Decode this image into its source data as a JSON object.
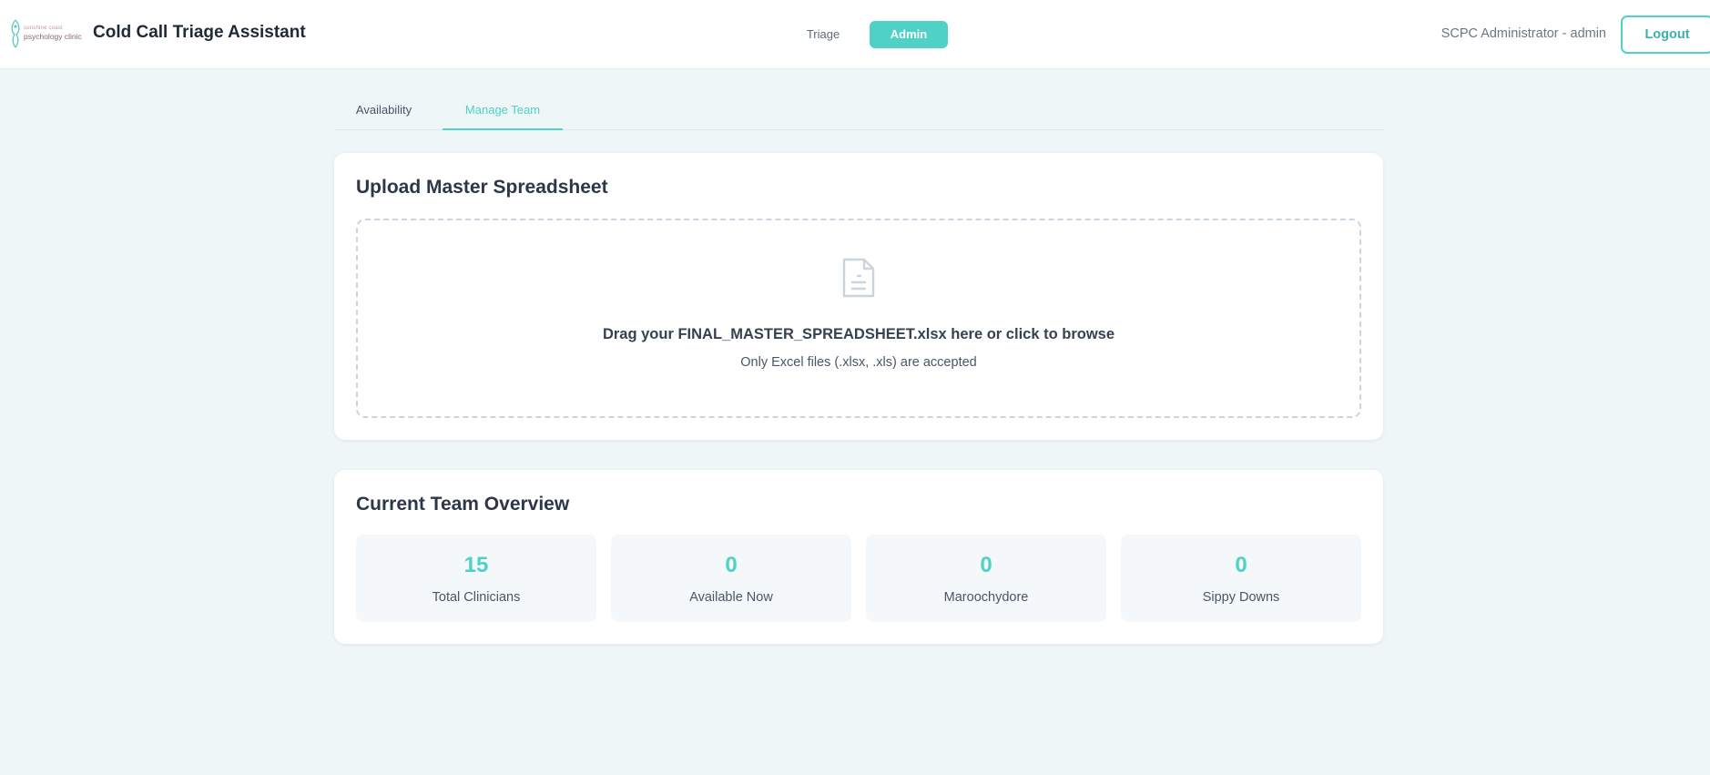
{
  "header": {
    "logo_top": "sunshine coast",
    "logo_main": "psychology clinic",
    "app_title": "Cold Call Triage Assistant",
    "nav": [
      {
        "label": "Triage",
        "active": false
      },
      {
        "label": "Admin",
        "active": true
      }
    ],
    "user_label": "SCPC Administrator - admin",
    "logout_label": "Logout"
  },
  "tabs": [
    {
      "label": "Availability",
      "active": false
    },
    {
      "label": "Manage Team",
      "active": true
    }
  ],
  "upload": {
    "title": "Upload Master Spreadsheet",
    "icon": "file-document-icon",
    "drop_text": "Drag your FINAL_MASTER_SPREADSHEET.xlsx here or click to browse",
    "hint_text": "Only Excel files (.xlsx, .xls) are accepted"
  },
  "overview": {
    "title": "Current Team Overview",
    "stats": [
      {
        "value": "15",
        "label": "Total Clinicians"
      },
      {
        "value": "0",
        "label": "Available Now"
      },
      {
        "value": "0",
        "label": "Maroochydore"
      },
      {
        "value": "0",
        "label": "Sippy Downs"
      }
    ]
  },
  "colors": {
    "accent": "#4fd1c5",
    "page_background": "#eef6f8",
    "card_background": "#ffffff"
  }
}
